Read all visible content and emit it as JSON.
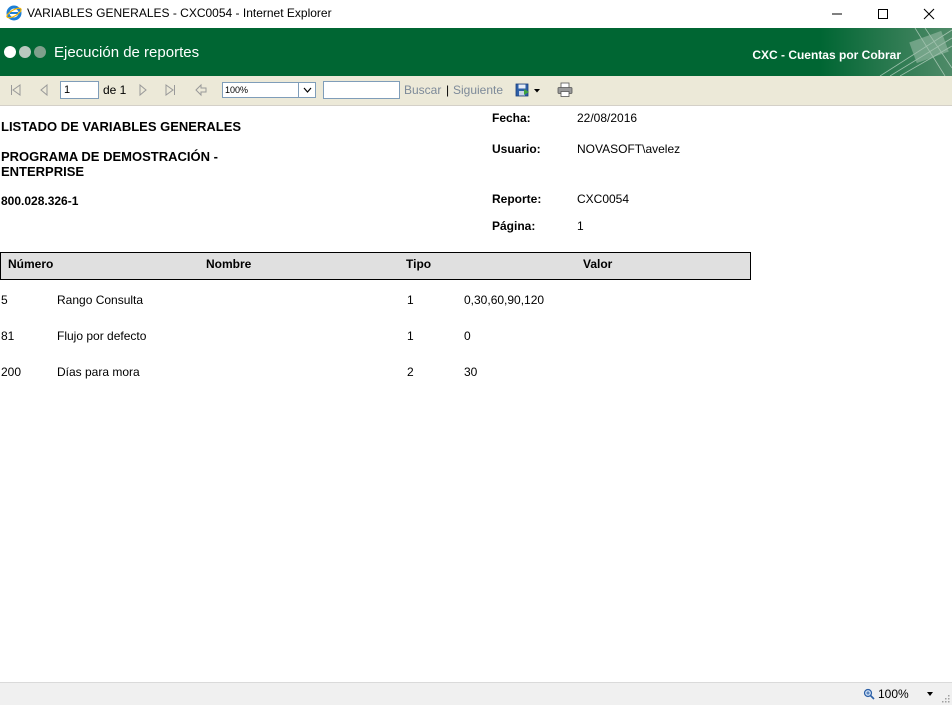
{
  "window": {
    "title": "VARIABLES GENERALES - CXC0054 - Internet Explorer"
  },
  "banner": {
    "title": "Ejecución de reportes",
    "module": "CXC - Cuentas por Cobrar",
    "brand_color": "#006633"
  },
  "toolbar": {
    "page_value": "1",
    "of_label": "de 1",
    "zoom_value": "100%",
    "search_value": "",
    "search_label": "Buscar",
    "separator": "|",
    "next_label": "Siguiente"
  },
  "report": {
    "title": "LISTADO DE VARIABLES GENERALES",
    "company": "PROGRAMA DE DEMOSTRACIÓN - ENTERPRISE",
    "nit": "800.028.326-1",
    "meta": {
      "date_label": "Fecha:",
      "date_value": "22/08/2016",
      "user_label": "Usuario:",
      "user_value": "NOVASOFT\\avelez",
      "report_label": "Reporte:",
      "report_value": "CXC0054",
      "page_label": "Página:",
      "page_value": "1"
    },
    "columns": [
      "Número",
      "Nombre",
      "Tipo",
      "Valor"
    ],
    "rows": [
      {
        "numero": "5",
        "nombre": "Rango Consulta",
        "tipo": "1",
        "valor": "0,30,60,90,120"
      },
      {
        "numero": "81",
        "nombre": "Flujo por defecto",
        "tipo": "1",
        "valor": "0"
      },
      {
        "numero": "200",
        "nombre": "Días para mora",
        "tipo": "2",
        "valor": "30"
      }
    ]
  },
  "statusbar": {
    "zoom": "100%"
  },
  "icons": [
    "ie-icon",
    "minimize-icon",
    "maximize-icon",
    "close-icon",
    "first-page-icon",
    "previous-page-icon",
    "next-page-icon",
    "last-page-icon",
    "back-icon",
    "export-icon",
    "print-icon",
    "zoom-icon"
  ]
}
